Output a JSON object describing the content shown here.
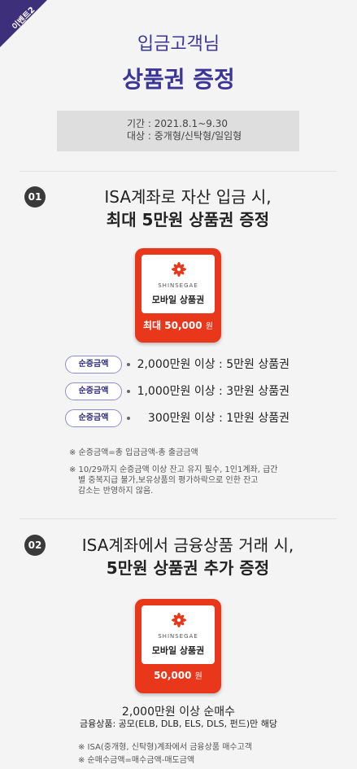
{
  "ribbon": {
    "label": "이벤트2",
    "color": "#3d2f7a"
  },
  "headline": {
    "line1": "입금고객님",
    "line2": "상품권 증정"
  },
  "period": {
    "line1": "기간 : 2021.8.1~9.30",
    "line2": "대상 : 중개형/신탁형/일임형"
  },
  "section1": {
    "number": "01",
    "title_line1": "ISA계좌로 자산 입금 시,",
    "title_line2": "최대 5만원 상품권 증정",
    "voucher": {
      "brand": "SHINSEGAE",
      "name": "모바일 상품권",
      "amount": "최대 50,000",
      "unit": "원"
    },
    "tiers": [
      {
        "badge": "순증금액",
        "text": "2,000만원 이상 : 5만원 상품권"
      },
      {
        "badge": "순증금액",
        "text": "1,000만원 이상 : 3만원 상품권"
      },
      {
        "badge": "순증금액",
        "text": "300만원 이상 : 1만원 상품권"
      }
    ],
    "notes": [
      "※ 순증금액=총 입금금액-총 출금금액",
      "※ 10/29까지 순증금액 이상 잔고 유지 필수, 1인1계좌, 급간",
      "별 중복지급 불가,보유상품의 평가하락으로 인한 잔고",
      "감소는 반영하지 않음."
    ]
  },
  "section2": {
    "number": "02",
    "title_line1": "ISA계좌에서 금융상품 거래 시,",
    "title_line2": "5만원 상품권 추가 증정",
    "voucher": {
      "brand": "SHINSEGAE",
      "name": "모바일 상품권",
      "amount": "50,000",
      "unit": "원"
    },
    "condition_line1": "2,000만원 이상 순매수",
    "condition_line2": "금융상품: 공모(ELB, DLB, ELS, DLS, 펀드)만 해당",
    "notes": [
      "※ ISA(중개형, 신탁형)계좌에서 금융상품 매수고객",
      "※ 순매수금액=매수금액-매도금액"
    ]
  },
  "colors": {
    "accent": "#3b3598",
    "voucher": "#e8371b",
    "badge": "#3a3a3a"
  }
}
